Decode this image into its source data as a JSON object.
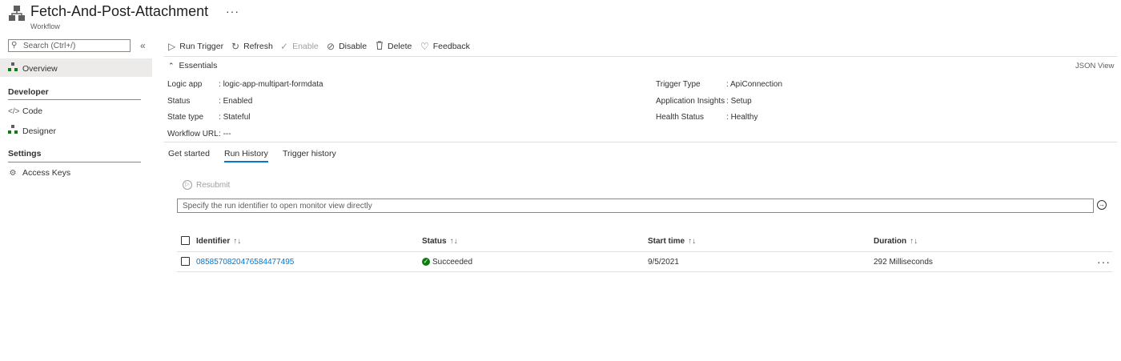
{
  "header": {
    "title": "Fetch-And-Post-Attachment",
    "subtitle": "Workflow",
    "more": "···"
  },
  "sidebar": {
    "search_placeholder": "Search (Ctrl+/)",
    "collapse_glyph": "«",
    "overview": "Overview",
    "developer_heading": "Developer",
    "code": "Code",
    "designer": "Designer",
    "settings_heading": "Settings",
    "access_keys": "Access Keys"
  },
  "toolbar": {
    "run_trigger": "Run Trigger",
    "refresh": "Refresh",
    "enable": "Enable",
    "disable": "Disable",
    "delete": "Delete",
    "feedback": "Feedback"
  },
  "essentials": {
    "label": "Essentials",
    "json_view": "JSON View",
    "left": [
      {
        "key": "Logic app",
        "value": "logic-app-multipart-formdata"
      },
      {
        "key": "Status",
        "value": "Enabled"
      },
      {
        "key": "State type",
        "value": "Stateful"
      },
      {
        "key": "Workflow URL",
        "value": "---"
      }
    ],
    "right": [
      {
        "key": "Trigger Type",
        "value": "ApiConnection"
      },
      {
        "key": "Application Insights",
        "value": "Setup"
      },
      {
        "key": "Health Status",
        "value": "Healthy"
      }
    ]
  },
  "tabs": [
    "Get started",
    "Run History",
    "Trigger history"
  ],
  "run_history": {
    "resubmit": "Resubmit",
    "run_id_placeholder": "Specify the run identifier to open monitor view directly",
    "columns": [
      "Identifier",
      "Status",
      "Start time",
      "Duration"
    ],
    "rows": [
      {
        "identifier": "08585708204765844774​95",
        "status": "Succeeded",
        "start_time": "9/5/2021",
        "duration": "292 Milliseconds"
      }
    ]
  },
  "colors": {
    "accent": "#0078d4",
    "success": "#107c10",
    "selected_bg": "#edebe9"
  }
}
